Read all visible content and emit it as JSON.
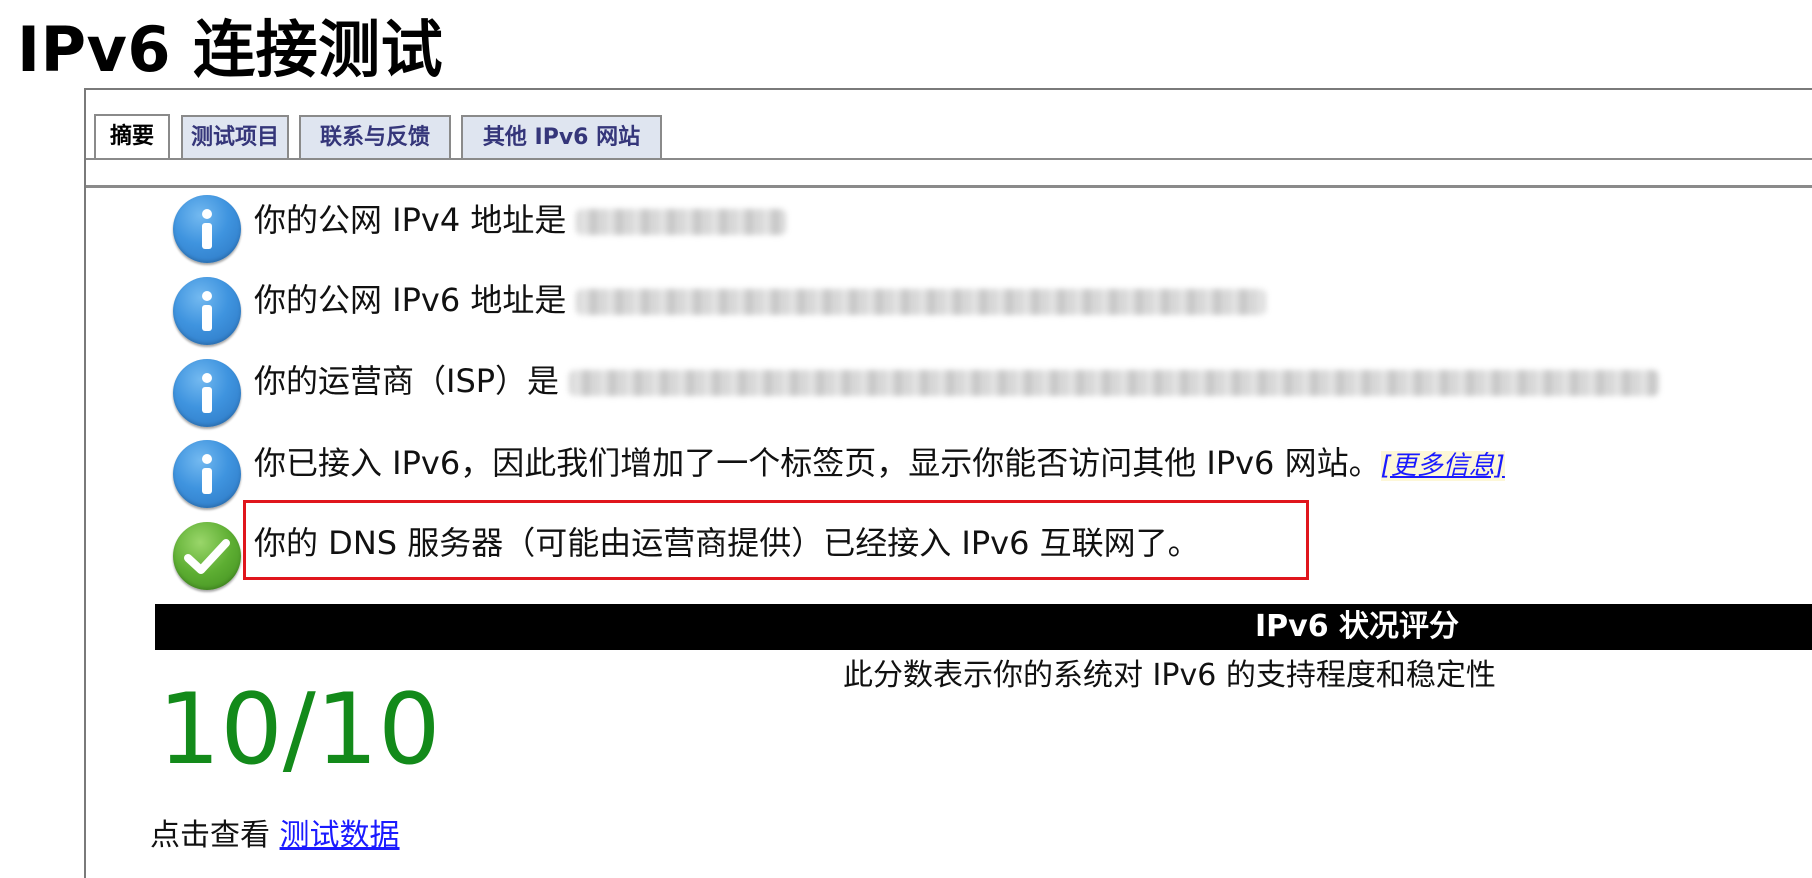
{
  "page": {
    "title": "IPv6 连接测试"
  },
  "tabs": [
    {
      "label": "摘要",
      "active": true
    },
    {
      "label": "测试项目",
      "active": false
    },
    {
      "label": "联系与反馈",
      "active": false
    },
    {
      "label": "其他 IPv6 网站",
      "active": false
    }
  ],
  "summary": {
    "rows": [
      {
        "icon": "info-icon",
        "text": "你的公网 IPv4 地址是",
        "value": "[redacted]"
      },
      {
        "icon": "info-icon",
        "text": "你的公网 IPv6 地址是",
        "value": "[redacted]"
      },
      {
        "icon": "info-icon",
        "text": "你的运营商（ISP）是",
        "value": "[redacted]"
      },
      {
        "icon": "info-icon",
        "text": "你已接入 IPv6，因此我们增加了一个标签页，显示你能否访问其他 IPv6 网站。",
        "link": "[更多信息]"
      },
      {
        "icon": "check-icon",
        "text": "你的 DNS 服务器（可能由运营商提供）已经接入 IPv6 互联网了。",
        "highlighted": true
      }
    ]
  },
  "score": {
    "header": "IPv6 状况评分",
    "description": "此分数表示你的系统对 IPv6 的支持程度和稳定性",
    "value": "10/10",
    "color": "#138a1a"
  },
  "footer": {
    "prefix": "点击查看",
    "link": "测试数据"
  },
  "colors": {
    "link": "#1a1aff",
    "highlight_border": "#e0151c",
    "tab_text": "#35367a",
    "tab_bg": "#dfe5f0"
  }
}
